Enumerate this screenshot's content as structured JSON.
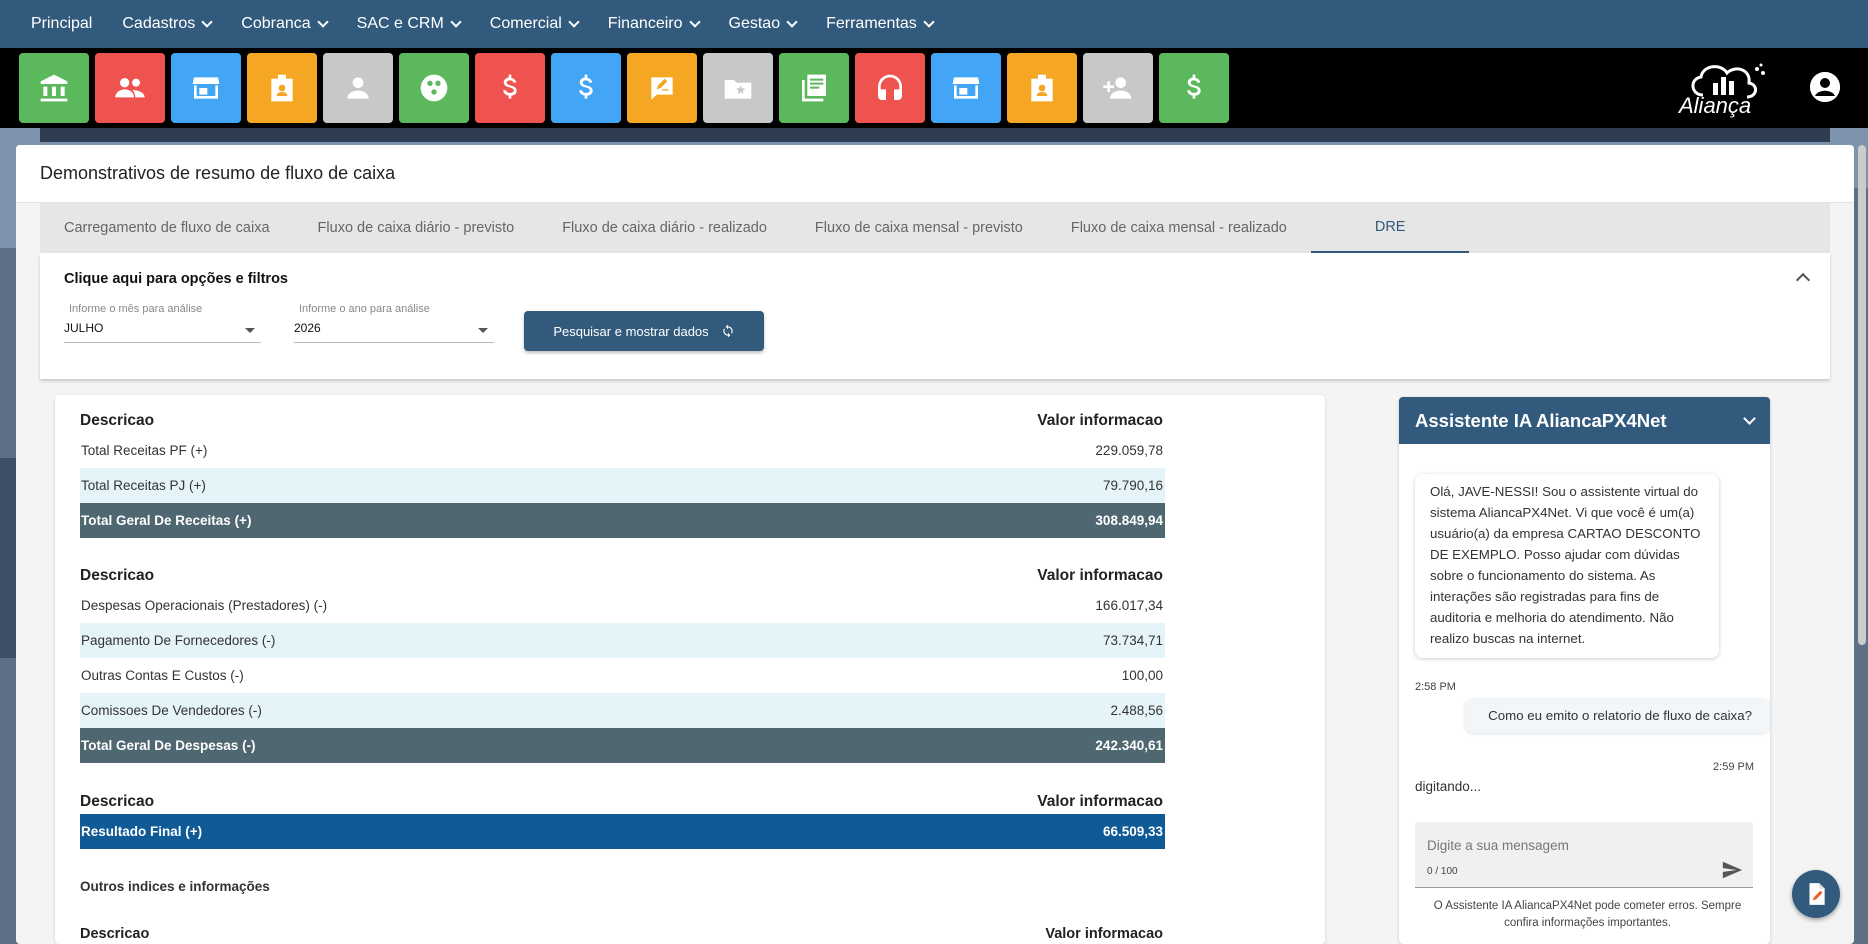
{
  "nav": {
    "items": [
      {
        "label": "Principal",
        "has_menu": false
      },
      {
        "label": "Cadastros",
        "has_menu": true
      },
      {
        "label": "Cobranca",
        "has_menu": true
      },
      {
        "label": "SAC e CRM",
        "has_menu": true
      },
      {
        "label": "Comercial",
        "has_menu": true
      },
      {
        "label": "Financeiro",
        "has_menu": true
      },
      {
        "label": "Gestao",
        "has_menu": true
      },
      {
        "label": "Ferramentas",
        "has_menu": true
      }
    ]
  },
  "toolbar": {
    "tiles": [
      {
        "icon": "bank-icon",
        "color": "#5cb85c"
      },
      {
        "icon": "people-icon",
        "color": "#ef5350"
      },
      {
        "icon": "store-icon",
        "color": "#42a5f5"
      },
      {
        "icon": "badge-icon",
        "color": "#f5a623"
      },
      {
        "icon": "person-icon",
        "color": "#c8c8c8"
      },
      {
        "icon": "circles-icon",
        "color": "#5cb85c"
      },
      {
        "icon": "dollar-icon",
        "color": "#ef5350"
      },
      {
        "icon": "dollar-icon",
        "color": "#42a5f5"
      },
      {
        "icon": "edit-note-icon",
        "color": "#f5a623"
      },
      {
        "icon": "folder-star-icon",
        "color": "#c8c8c8"
      },
      {
        "icon": "library-books-icon",
        "color": "#5cb85c"
      },
      {
        "icon": "headset-icon",
        "color": "#ef5350"
      },
      {
        "icon": "store-icon",
        "color": "#42a5f5"
      },
      {
        "icon": "badge-icon",
        "color": "#f5a623"
      },
      {
        "icon": "person-add-icon",
        "color": "#c8c8c8"
      },
      {
        "icon": "dollar-icon",
        "color": "#5cb85c"
      }
    ],
    "logo_text": "Aliança"
  },
  "page": {
    "title": "Demonstrativos de resumo de fluxo de caixa",
    "tabs": [
      {
        "label": "Carregamento de fluxo de caixa",
        "active": false
      },
      {
        "label": "Fluxo de caixa diário - previsto",
        "active": false
      },
      {
        "label": "Fluxo de caixa diário - realizado",
        "active": false
      },
      {
        "label": "Fluxo de caixa mensal - previsto",
        "active": false
      },
      {
        "label": "Fluxo de caixa mensal - realizado",
        "active": false
      },
      {
        "label": "DRE",
        "active": true
      }
    ]
  },
  "filters": {
    "title": "Clique aqui para opções e filtros",
    "month_label": "Informe o mês para análise",
    "month_value": "JULHO",
    "year_label": "Informe o ano para análise",
    "year_value": "2026",
    "search_button": "Pesquisar e mostrar dados"
  },
  "report": {
    "col_desc": "Descricao",
    "col_value": "Valor informacao",
    "receitas": [
      {
        "desc": "Total Receitas PF (+)",
        "value": "229.059,78"
      },
      {
        "desc": "Total Receitas PJ (+)",
        "value": "79.790,16"
      }
    ],
    "receitas_total": {
      "desc": "Total Geral De Receitas (+)",
      "value": "308.849,94"
    },
    "despesas": [
      {
        "desc": "Despesas Operacionais (Prestadores) (-)",
        "value": "166.017,34"
      },
      {
        "desc": "Pagamento De Fornecedores (-)",
        "value": "73.734,71"
      },
      {
        "desc": "Outras Contas E Custos (-)",
        "value": "100,00"
      },
      {
        "desc": "Comissoes De Vendedores (-)",
        "value": "2.488,56"
      }
    ],
    "despesas_total": {
      "desc": "Total Geral De Despesas (-)",
      "value": "242.340,61"
    },
    "resultado": {
      "desc": "Resultado Final (+)",
      "value": "66.509,33"
    },
    "outros_title": "Outros indices e informações"
  },
  "chat": {
    "title": "Assistente IA AliancaPX4Net",
    "bot_message": "Olá, JAVE-NESSI! Sou o assistente virtual do sistema AliancaPX4Net. Vi que você é um(a) usuário(a) da empresa CARTAO DESCONTO DE EXEMPLO. Posso ajudar com dúvidas sobre o funcionamento do sistema. As interações são registradas para fins de auditoria e melhoria do atendimento. Não realizo buscas na internet.",
    "bot_time": "2:58 PM",
    "user_message": "Como eu emito o relatorio de fluxo de caixa?",
    "user_time": "2:59 PM",
    "typing": "digitando...",
    "input_placeholder": "Digite a sua mensagem",
    "counter": "0 / 100",
    "disclaimer": "O Assistente IA AliancaPX4Net pode cometer erros. Sempre confira informações importantes."
  }
}
